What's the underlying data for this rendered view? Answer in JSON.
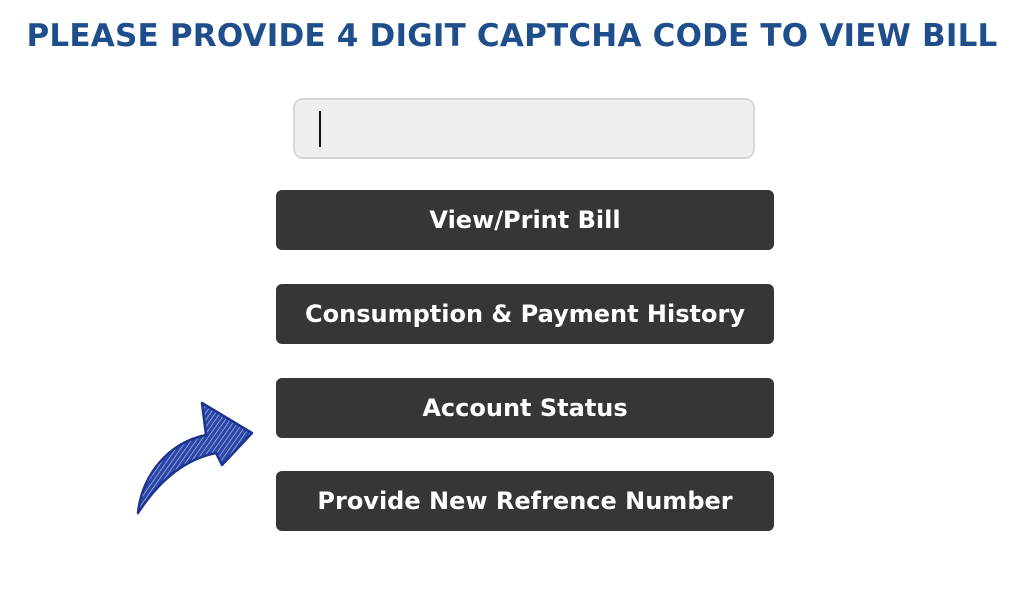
{
  "heading": "PLEASE PROVIDE 4 DIGIT CAPTCHA CODE TO VIEW BILL",
  "captcha": {
    "value": "",
    "placeholder": ""
  },
  "buttons": {
    "view_print_bill": "View/Print Bill",
    "consumption_payment_history": "Consumption & Payment History",
    "account_status": "Account Status",
    "provide_new_reference": "Provide New Refrence Number"
  },
  "colors": {
    "heading": "#1f4e8c",
    "button_bg": "#363636",
    "button_text": "#ffffff",
    "input_bg": "#efefef",
    "arrow": "#2a46a8"
  },
  "icons": {
    "pointer_arrow": "curved-arrow-icon"
  }
}
